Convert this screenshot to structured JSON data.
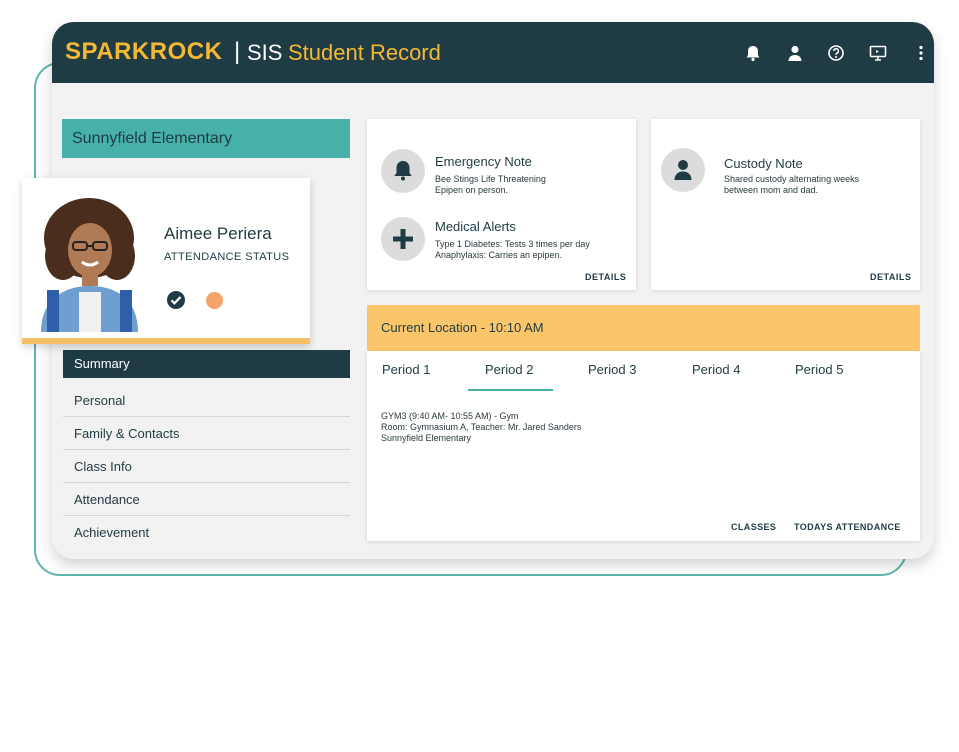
{
  "header": {
    "logo": "SPARKROCK",
    "divider": "|",
    "sis": "SIS",
    "title": "Student Record",
    "icons": [
      "bell-icon",
      "user-icon",
      "help-icon",
      "screen-icon",
      "more-icon"
    ]
  },
  "school": "Sunnyfield Elementary",
  "student": {
    "name": "Aimee Periera",
    "status_label": "ATTENDANCE STATUS"
  },
  "nav": [
    "Summary",
    "Personal",
    "Family & Contacts",
    "Class Info",
    "Attendance",
    "Achievement"
  ],
  "notes": {
    "emergency_title": "Emergency Note",
    "emergency_line1": "Bee Stings Life Threatening",
    "emergency_line2": "Epipen on person.",
    "medical_title": "Medical Alerts",
    "medical_line1": "Type 1 Diabetes: Tests 3 times per day",
    "medical_line2": "Anaphylaxis: Carries an epipen.",
    "details": "DETAILS",
    "custody_title": "Custody Note",
    "custody_line1": "Shared custody alternating weeks",
    "custody_line2": "between mom and dad."
  },
  "location": {
    "title": "Current Location - 10:10 AM",
    "tabs": [
      "Period 1",
      "Period 2",
      "Period 3",
      "Period 4",
      "Period 5"
    ],
    "selected_tab": "Period 2",
    "class_line1": "GYM3 (9:40 AM- 10:55 AM) - Gym",
    "class_line2": "Room: Gymnasium A, Teacher: Mr. Jared Sanders",
    "class_line3": "Sunnyfield Elementary",
    "classes": "CLASSES",
    "attendance": "TODAYS ATTENDANCE"
  },
  "colors": {
    "header": "#1f3b43",
    "accent": "#f5b835",
    "teal": "#47b0a8",
    "location_bar": "#fbc66a",
    "status_orange": "#f4a36a"
  }
}
